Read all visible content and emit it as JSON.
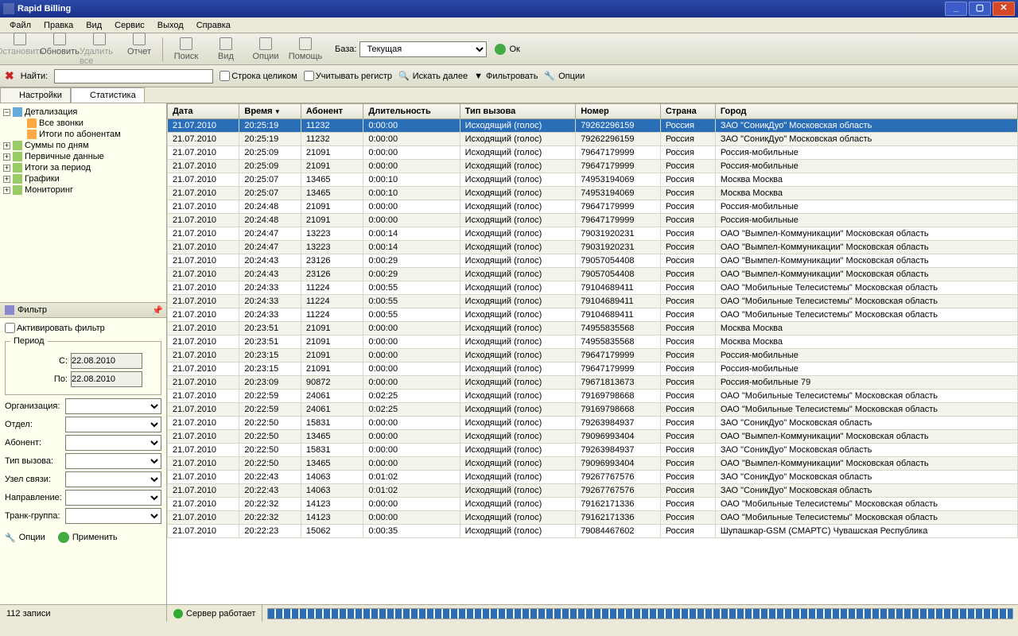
{
  "title": "Rapid Billing",
  "menu": [
    "Файл",
    "Правка",
    "Вид",
    "Сервис",
    "Выход",
    "Справка"
  ],
  "toolbar1": [
    {
      "label": "Остановить",
      "disabled": true
    },
    {
      "label": "Обновить"
    },
    {
      "label": "Удалить все",
      "disabled": true
    },
    {
      "label": "Отчет"
    }
  ],
  "toolbar2": [
    {
      "label": "Поиск"
    },
    {
      "label": "Вид"
    },
    {
      "label": "Опции"
    },
    {
      "label": "Помощь"
    }
  ],
  "base_label": "База:",
  "base_value": "Текущая",
  "ok_label": "Ок",
  "search": {
    "label": "Найти:",
    "whole": "Строка целиком",
    "case": "Учитывать регистр",
    "next": "Искать далее",
    "filter": "Фильтровать",
    "opts": "Опции"
  },
  "tabs": [
    {
      "label": "Настройки"
    },
    {
      "label": "Статистика",
      "active": true
    }
  ],
  "tree": {
    "root": "Детализация",
    "children": [
      "Все звонки",
      "Итоги по абонентам"
    ],
    "nodes": [
      "Суммы по дням",
      "Первичные данные",
      "Итоги за период",
      "Графики",
      "Мониторинг"
    ]
  },
  "filter": {
    "title": "Фильтр",
    "activate": "Активировать фильтр",
    "period": "Период",
    "from": "С:",
    "to": "По:",
    "date": "22.08.2010",
    "labels": [
      "Организация:",
      "Отдел:",
      "Абонент:",
      "Тип вызова:",
      "Узел связи:",
      "Направление:",
      "Транк-группа:"
    ],
    "opt": "Опции",
    "apply": "Применить"
  },
  "columns": [
    "Дата",
    "Время",
    "Абонент",
    "Длительность",
    "Тип вызова",
    "Номер",
    "Страна",
    "Город"
  ],
  "sort_col": 1,
  "rows": [
    [
      "21.07.2010",
      "20:25:19",
      "11232",
      "0:00:00",
      "Исходящий (голос)",
      "79262296159",
      "Россия",
      "ЗАО \"СоникДуо\"   Московская область"
    ],
    [
      "21.07.2010",
      "20:25:19",
      "11232",
      "0:00:00",
      "Исходящий (голос)",
      "79262296159",
      "Россия",
      "ЗАО \"СоникДуо\"   Московская область"
    ],
    [
      "21.07.2010",
      "20:25:09",
      "21091",
      "0:00:00",
      "Исходящий (голос)",
      "79647179999",
      "Россия",
      "Россия-мобильные"
    ],
    [
      "21.07.2010",
      "20:25:09",
      "21091",
      "0:00:00",
      "Исходящий (голос)",
      "79647179999",
      "Россия",
      "Россия-мобильные"
    ],
    [
      "21.07.2010",
      "20:25:07",
      "13465",
      "0:00:10",
      "Исходящий (голос)",
      "74953194069",
      "Россия",
      "Москва   Москва"
    ],
    [
      "21.07.2010",
      "20:25:07",
      "13465",
      "0:00:10",
      "Исходящий (голос)",
      "74953194069",
      "Россия",
      "Москва   Москва"
    ],
    [
      "21.07.2010",
      "20:24:48",
      "21091",
      "0:00:00",
      "Исходящий (голос)",
      "79647179999",
      "Россия",
      "Россия-мобильные"
    ],
    [
      "21.07.2010",
      "20:24:48",
      "21091",
      "0:00:00",
      "Исходящий (голос)",
      "79647179999",
      "Россия",
      "Россия-мобильные"
    ],
    [
      "21.07.2010",
      "20:24:47",
      "13223",
      "0:00:14",
      "Исходящий (голос)",
      "79031920231",
      "Россия",
      "ОАО \"Вымпел-Коммуникации\"   Московская область"
    ],
    [
      "21.07.2010",
      "20:24:47",
      "13223",
      "0:00:14",
      "Исходящий (голос)",
      "79031920231",
      "Россия",
      "ОАО \"Вымпел-Коммуникации\"   Московская область"
    ],
    [
      "21.07.2010",
      "20:24:43",
      "23126",
      "0:00:29",
      "Исходящий (голос)",
      "79057054408",
      "Россия",
      "ОАО \"Вымпел-Коммуникации\"   Московская область"
    ],
    [
      "21.07.2010",
      "20:24:43",
      "23126",
      "0:00:29",
      "Исходящий (голос)",
      "79057054408",
      "Россия",
      "ОАО \"Вымпел-Коммуникации\"   Московская область"
    ],
    [
      "21.07.2010",
      "20:24:33",
      "11224",
      "0:00:55",
      "Исходящий (голос)",
      "79104689411",
      "Россия",
      "ОАО \"Мобильные Телесистемы\"   Московская область"
    ],
    [
      "21.07.2010",
      "20:24:33",
      "11224",
      "0:00:55",
      "Исходящий (голос)",
      "79104689411",
      "Россия",
      "ОАО \"Мобильные Телесистемы\"   Московская область"
    ],
    [
      "21.07.2010",
      "20:24:33",
      "11224",
      "0:00:55",
      "Исходящий (голос)",
      "79104689411",
      "Россия",
      "ОАО \"Мобильные Телесистемы\"   Московская область"
    ],
    [
      "21.07.2010",
      "20:23:51",
      "21091",
      "0:00:00",
      "Исходящий (голос)",
      "74955835568",
      "Россия",
      "Москва   Москва"
    ],
    [
      "21.07.2010",
      "20:23:51",
      "21091",
      "0:00:00",
      "Исходящий (голос)",
      "74955835568",
      "Россия",
      "Москва   Москва"
    ],
    [
      "21.07.2010",
      "20:23:15",
      "21091",
      "0:00:00",
      "Исходящий (голос)",
      "79647179999",
      "Россия",
      "Россия-мобильные"
    ],
    [
      "21.07.2010",
      "20:23:15",
      "21091",
      "0:00:00",
      "Исходящий (голос)",
      "79647179999",
      "Россия",
      "Россия-мобильные"
    ],
    [
      "21.07.2010",
      "20:23:09",
      "90872",
      "0:00:00",
      "Исходящий (голос)",
      "79671813673",
      "Россия",
      "Россия-мобильные 79"
    ],
    [
      "21.07.2010",
      "20:22:59",
      "24061",
      "0:02:25",
      "Исходящий (голос)",
      "79169798668",
      "Россия",
      "ОАО \"Мобильные Телесистемы\"   Московская область"
    ],
    [
      "21.07.2010",
      "20:22:59",
      "24061",
      "0:02:25",
      "Исходящий (голос)",
      "79169798668",
      "Россия",
      "ОАО \"Мобильные Телесистемы\"   Московская область"
    ],
    [
      "21.07.2010",
      "20:22:50",
      "15831",
      "0:00:00",
      "Исходящий (голос)",
      "79263984937",
      "Россия",
      "ЗАО \"СоникДуо\"   Московская область"
    ],
    [
      "21.07.2010",
      "20:22:50",
      "13465",
      "0:00:00",
      "Исходящий (голос)",
      "79096993404",
      "Россия",
      "ОАО \"Вымпел-Коммуникации\"   Московская область"
    ],
    [
      "21.07.2010",
      "20:22:50",
      "15831",
      "0:00:00",
      "Исходящий (голос)",
      "79263984937",
      "Россия",
      "ЗАО \"СоникДуо\"   Московская область"
    ],
    [
      "21.07.2010",
      "20:22:50",
      "13465",
      "0:00:00",
      "Исходящий (голос)",
      "79096993404",
      "Россия",
      "ОАО \"Вымпел-Коммуникации\"   Московская область"
    ],
    [
      "21.07.2010",
      "20:22:43",
      "14063",
      "0:01:02",
      "Исходящий (голос)",
      "79267767576",
      "Россия",
      "ЗАО \"СоникДуо\"   Московская область"
    ],
    [
      "21.07.2010",
      "20:22:43",
      "14063",
      "0:01:02",
      "Исходящий (голос)",
      "79267767576",
      "Россия",
      "ЗАО \"СоникДуо\"   Московская область"
    ],
    [
      "21.07.2010",
      "20:22:32",
      "14123",
      "0:00:00",
      "Исходящий (голос)",
      "79162171336",
      "Россия",
      "ОАО \"Мобильные Телесистемы\"   Московская область"
    ],
    [
      "21.07.2010",
      "20:22:32",
      "14123",
      "0:00:00",
      "Исходящий (голос)",
      "79162171336",
      "Россия",
      "ОАО \"Мобильные Телесистемы\"   Московская область"
    ],
    [
      "21.07.2010",
      "20:22:23",
      "15062",
      "0:00:35",
      "Исходящий (голос)",
      "79084467602",
      "Россия",
      "Шупашкар-GSM (СМАРТС)   Чувашская Республика"
    ]
  ],
  "status": {
    "count": "112 записи",
    "server": "Сервер работает"
  }
}
